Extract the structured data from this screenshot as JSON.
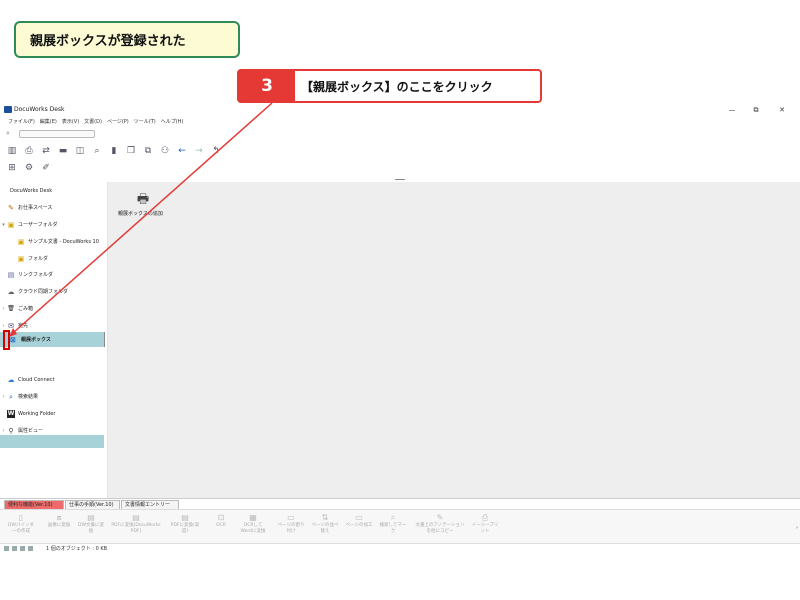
{
  "callout": {
    "note": "親展ボックスが登録された",
    "step_number": "3",
    "step_text": "【親展ボックス】のここをクリック"
  },
  "window": {
    "title": "DocuWorks Desk",
    "buttons": [
      "—",
      "⧉",
      "✕"
    ]
  },
  "menu": [
    "ファイル(F)",
    "編集(E)",
    "表示(V)",
    "文書(D)",
    "ページ(P)",
    "ツール(T)",
    "ヘルプ(H)"
  ],
  "sidebar": {
    "items": [
      {
        "label": "DocuWorks Desk",
        "icon": "",
        "chevron": ""
      },
      {
        "label": "お仕事スペース",
        "icon": "✎",
        "chevron": ""
      },
      {
        "label": "ユーザーフォルダ",
        "icon": "▣",
        "chevron": "▾"
      },
      {
        "label": "サンプル文書 - DocuWorks 10",
        "icon": "▣",
        "chevron": ""
      },
      {
        "label": "フォルダ",
        "icon": "▣",
        "chevron": ""
      },
      {
        "label": "リンクフォルダ",
        "icon": "▤",
        "chevron": ""
      },
      {
        "label": "クラウド同期フォルダ",
        "icon": "☁",
        "chevron": ""
      },
      {
        "label": "ごみ箱",
        "icon": "🗑",
        "chevron": "›"
      },
      {
        "label": "宛先",
        "icon": "✉",
        "chevron": "›"
      },
      {
        "label": "親展ボックス",
        "icon": "⊠",
        "chevron": ""
      },
      {
        "label": "Cloud Connect",
        "icon": "☁",
        "chevron": ""
      },
      {
        "label": "検索結果",
        "icon": "⌕",
        "chevron": "›"
      },
      {
        "label": "Working Folder",
        "icon": "W",
        "chevron": ""
      },
      {
        "label": "属性ビュー",
        "icon": "⚲",
        "chevron": "›"
      }
    ]
  },
  "main": {
    "item_label": "親展ボックスの追加",
    "item_icon": "🖶"
  },
  "tabs": [
    "便利な機能(Ver.10)",
    "仕事の手順(Ver.10)",
    "文書情報エントリー"
  ],
  "bottom_buttons": [
    "DWバインダーの作成",
    "画像に変換",
    "DW文書に変換",
    "PDFに変換(DocuWorks PDF)",
    "PDFに変換(高度)",
    "OCR",
    "OCRしてWordに変換",
    "ページの割り付け",
    "ページの並べ替え",
    "ページの加工",
    "検索してマーク",
    "文書上のアノテーションを他にコピー",
    "イージープリント"
  ],
  "status": {
    "text": "1 個のオブジェクト : 0 KB"
  },
  "colors": {
    "accent_red": "#e53935",
    "selection": "#a7d3d8",
    "note_border": "#2e8b57",
    "note_bg": "#fdfbd4"
  }
}
